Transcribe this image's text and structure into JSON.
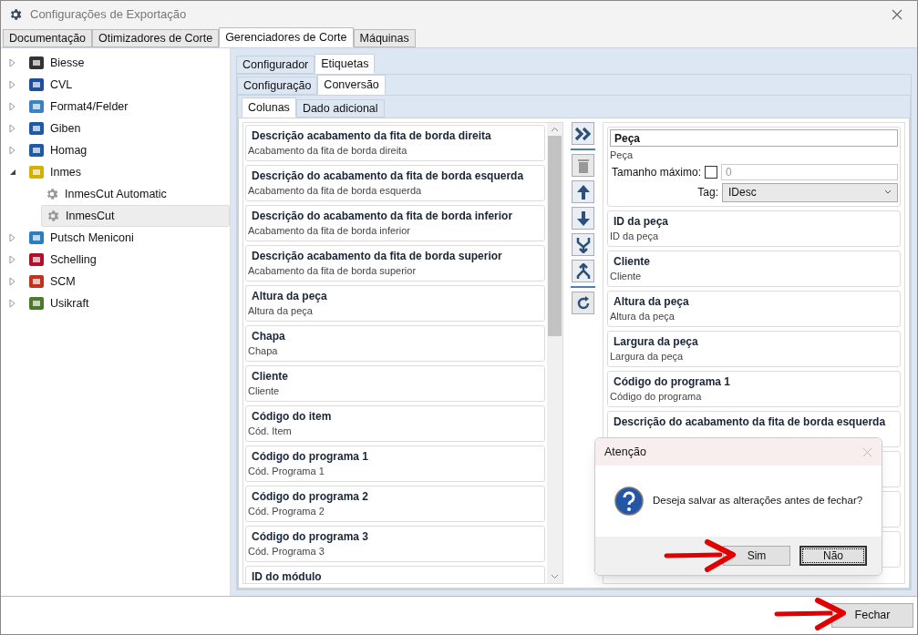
{
  "window": {
    "title": "Configurações de Exportação"
  },
  "tabs": [
    {
      "label": "Documentação",
      "selected": false
    },
    {
      "label": "Otimizadores de Corte",
      "selected": false
    },
    {
      "label": "Gerenciadores de Corte",
      "selected": true
    },
    {
      "label": "Máquinas",
      "selected": false
    }
  ],
  "tree": [
    {
      "label": "Biesse",
      "expanded": false,
      "selected": false
    },
    {
      "label": "CVL",
      "expanded": false,
      "selected": false
    },
    {
      "label": "Format4/Felder",
      "expanded": false,
      "selected": false
    },
    {
      "label": "Giben",
      "expanded": false,
      "selected": false
    },
    {
      "label": "Homag",
      "expanded": false,
      "selected": false
    },
    {
      "label": "Inmes",
      "expanded": true,
      "selected": false,
      "children": [
        {
          "label": "InmesCut Automatic",
          "selected": false
        },
        {
          "label": "InmesCut",
          "selected": true
        }
      ]
    },
    {
      "label": "Putsch Meniconi",
      "expanded": false,
      "selected": false
    },
    {
      "label": "Schelling",
      "expanded": false,
      "selected": false
    },
    {
      "label": "SCM",
      "expanded": false,
      "selected": false
    },
    {
      "label": "Usikraft",
      "expanded": false,
      "selected": false
    }
  ],
  "subtabs_1": [
    {
      "label": "Configurador",
      "selected": false
    },
    {
      "label": "Etiquetas",
      "selected": true
    }
  ],
  "subtabs_2": [
    {
      "label": "Configuração",
      "selected": false
    },
    {
      "label": "Conversão",
      "selected": true
    }
  ],
  "subtabs_3": [
    {
      "label": "Colunas",
      "selected": true
    },
    {
      "label": "Dado adicional",
      "selected": false
    }
  ],
  "available_columns": [
    {
      "title": "Descrição acabamento da fita de borda direita",
      "subtitle": "Acabamento da fita de borda direita"
    },
    {
      "title": "Descrição do acabamento da fita de borda esquerda",
      "subtitle": "Acabamento da fita de borda esquerda"
    },
    {
      "title": "Descrição do acabamento da fita de borda inferior",
      "subtitle": "Acabamento da fita de borda inferior"
    },
    {
      "title": "Descrição acabamento da fita de borda superior",
      "subtitle": "Acabamento da fita de borda superior"
    },
    {
      "title": "Altura da peça",
      "subtitle": "Altura da peça"
    },
    {
      "title": "Chapa",
      "subtitle": "Chapa"
    },
    {
      "title": "Cliente",
      "subtitle": "Cliente"
    },
    {
      "title": "Código do item",
      "subtitle": "Cód. Item"
    },
    {
      "title": "Código do programa 1",
      "subtitle": "Cód. Programa 1"
    },
    {
      "title": "Código do programa 2",
      "subtitle": "Cód. Programa 2"
    },
    {
      "title": "Código do programa 3",
      "subtitle": "Cód. Programa 3"
    },
    {
      "title": "ID do módulo"
    }
  ],
  "editor": {
    "name": "Peça",
    "subtitle": "Peça",
    "max_label": "Tamanho máximo:",
    "max_checked": false,
    "max_value": "0",
    "tag_label": "Tag:",
    "tag_value": "IDesc"
  },
  "selected_columns": [
    {
      "title": "ID da peça",
      "subtitle": "ID da peça"
    },
    {
      "title": "Cliente",
      "subtitle": "Cliente"
    },
    {
      "title": "Altura da peça",
      "subtitle": "Altura da peça"
    },
    {
      "title": "Largura da peça",
      "subtitle": "Largura da peça"
    },
    {
      "title": "Código do programa 1",
      "subtitle": "Código do programa"
    },
    {
      "title": "Descrição do acabamento da fita de borda esquerda"
    }
  ],
  "dialog": {
    "title": "Atenção",
    "message": "Deseja salvar as alterações antes de fechar?",
    "buttons": [
      {
        "label": "Sim",
        "focused": false
      },
      {
        "label": "Não",
        "focused": true
      }
    ]
  },
  "footer": {
    "button": "Fechar"
  }
}
